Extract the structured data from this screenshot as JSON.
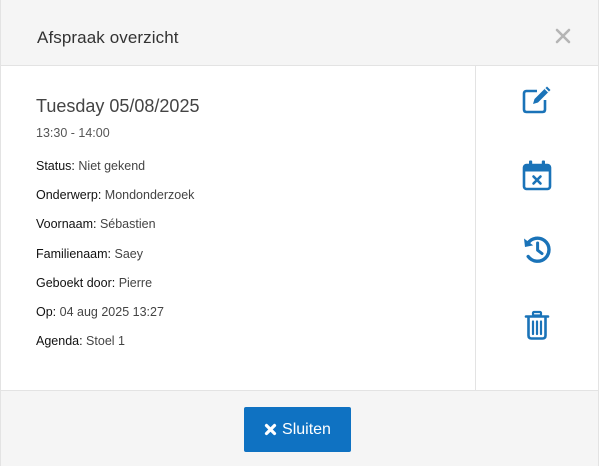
{
  "dialog": {
    "title": "Afspraak overzicht",
    "close_icon": "times-icon"
  },
  "appointment": {
    "date": "Tuesday 05/08/2025",
    "time": "13:30 - 14:00",
    "fields": [
      {
        "label": "Status:",
        "value": " Niet gekend"
      },
      {
        "label": "Onderwerp:",
        "value": " Mondonderzoek"
      },
      {
        "label": "Voornaam:",
        "value": " Sébastien"
      },
      {
        "label": "Familienaam:",
        "value": " Saey"
      },
      {
        "label": "Geboekt door:",
        "value": " Pierre"
      },
      {
        "label": "Op:",
        "value": " 04 aug 2025 13:27"
      },
      {
        "label": "Agenda:",
        "value": " Stoel 1"
      }
    ]
  },
  "actions": [
    {
      "name": "edit",
      "icon": "pencil-square-icon"
    },
    {
      "name": "cancel",
      "icon": "calendar-times-icon"
    },
    {
      "name": "reschedule",
      "icon": "history-icon"
    },
    {
      "name": "delete",
      "icon": "trash-icon"
    }
  ],
  "footer": {
    "close_label": "Sluiten",
    "close_icon": "times-icon"
  },
  "colors": {
    "primary": "#0f72c2",
    "icon": "#1a73b8",
    "header_bg": "#f5f5f5",
    "border": "#e3e3e3"
  }
}
